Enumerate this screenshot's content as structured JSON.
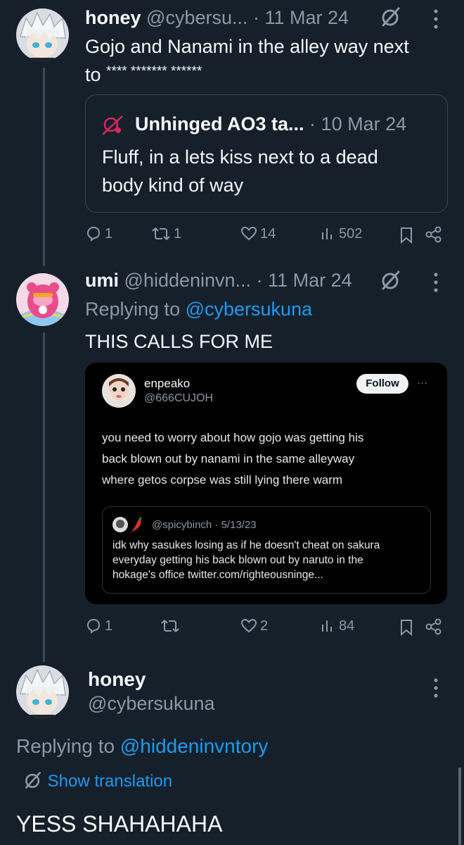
{
  "tweet1": {
    "name": "honey",
    "handle": "@cybersu...",
    "sep": "·",
    "date": "11 Mar 24",
    "text_line1": "Gojo and Nanami in the alley way next",
    "text_line2_prefix": "to",
    "text_line2_masked": "**** ******* ******",
    "quote": {
      "name": "Unhinged AO3 ta...",
      "sep": "·",
      "date": "10 Mar 24",
      "line1": "Fluff, in a lets kiss next to a dead",
      "line2": "body kind of way"
    },
    "actions": {
      "replies": "1",
      "reposts": "1",
      "likes": "14",
      "views": "502"
    }
  },
  "tweet2": {
    "name": "umi",
    "handle": "@hiddeninvn...",
    "sep": "·",
    "date": "11 Mar 24",
    "replying_prefix": "Replying to",
    "replying_handle": "@cybersukuna",
    "text": "THIS CALLS FOR ME",
    "embed": {
      "name": "enpeako",
      "handle": "@666CUJOH",
      "follow_label": "Follow",
      "more": "···",
      "line1": "you need to worry about how gojo was getting his",
      "line2": "back blown out by nanami in the same alleyway",
      "line3": "where getos corpse was still lying there warm",
      "inner": {
        "handle_date": "@spicybinch · 5/13/23",
        "line1": "idk why sasukes losing as if he doesn't cheat on sakura",
        "line2": "everyday getting his back blown out by naruto in the",
        "line3": "hokage's office twitter.com/righteousninge..."
      }
    },
    "actions": {
      "replies": "1",
      "reposts": "",
      "likes": "2",
      "views": "84"
    }
  },
  "tweet3": {
    "name": "honey",
    "handle": "@cybersukuna",
    "replying_prefix": "Replying to",
    "replying_handle": "@hiddeninvntory",
    "show_translation": "Show translation",
    "text": "YESS SHAHAHAHA"
  },
  "colors": {
    "background": "#15202b",
    "accent": "#1d9bf0",
    "muted": "#8b98a5",
    "border": "#38444d"
  }
}
